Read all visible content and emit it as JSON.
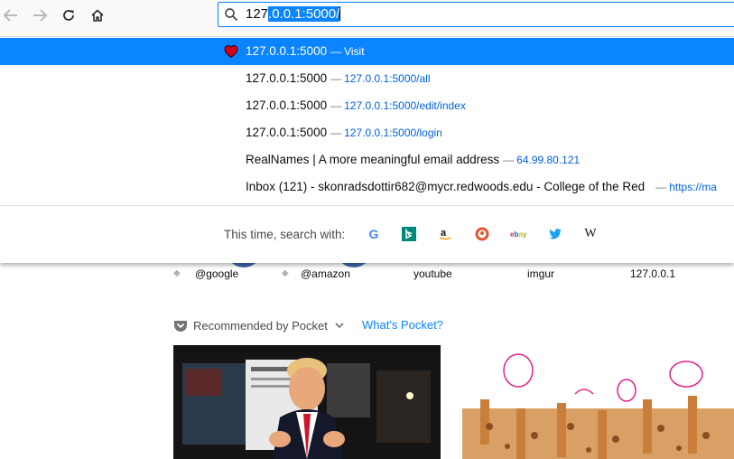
{
  "urlbar": {
    "typed": "127",
    "autofill": ".0.0.1:5000/"
  },
  "results": [
    {
      "title": "127.0.0.1:5000",
      "action": "Visit",
      "icon": "heart-icon",
      "selected": true
    },
    {
      "title": "127.0.0.1:5000",
      "action": "127.0.0.1:5000/all"
    },
    {
      "title": "127.0.0.1:5000",
      "action": "127.0.0.1:5000/edit/index"
    },
    {
      "title": "127.0.0.1:5000",
      "action": "127.0.0.1:5000/login"
    },
    {
      "title": "RealNames | A more meaningful email address",
      "action": "64.99.80.121"
    },
    {
      "title": "Inbox (121) - skonradsdottir682@mycr.redwoods.edu - College of the Red",
      "action": "https://ma"
    }
  ],
  "separator": "—",
  "oneoff": {
    "label": "This time, search with:",
    "engines": [
      "google-icon",
      "bing-icon",
      "amazon-icon",
      "duckduckgo-icon",
      "ebay-icon",
      "twitter-icon",
      "wikipedia-icon"
    ]
  },
  "topsites": [
    "@google",
    "@amazon",
    "youtube",
    "imgur",
    "127.0.0.1"
  ],
  "pocket": {
    "title": "Recommended by Pocket",
    "link": "What's Pocket?"
  },
  "colors": {
    "accent": "#0a84ff",
    "link": "#0060df",
    "toolbar": "#f9f9fa"
  }
}
